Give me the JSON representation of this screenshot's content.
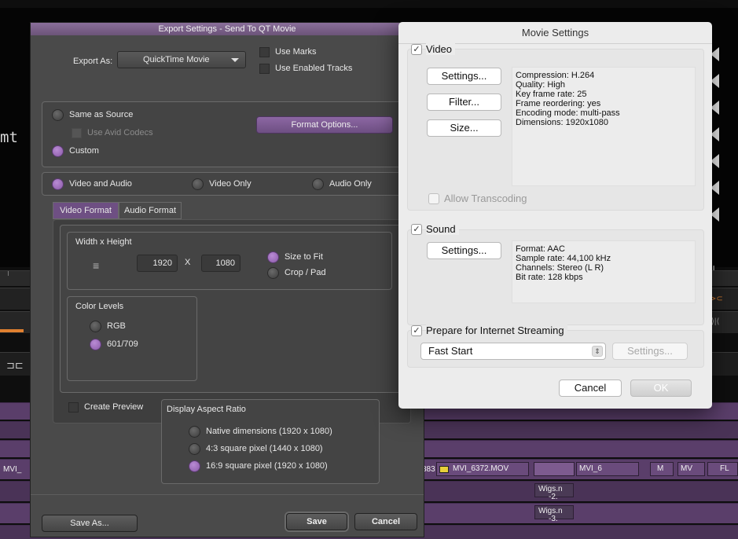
{
  "background": {
    "viewer_text": "mt",
    "viewer_ii": "II",
    "bar_right_glyph": "⊳⊂",
    "bar_right_glyph2": "⟩|⟨",
    "bar_left_glyph": "⊐⊏",
    "clips": {
      "mvi_left": "MVI_",
      "mvi_383": "383",
      "mvi_6372": "MVI_6372.MOV",
      "mvi_6": "MVI_6",
      "m": "M",
      "mv": "MV",
      "fl": "FL",
      "wigs1": "Wigs.n",
      "wigs2": "Wigs.n",
      "gain1": "-2.",
      "gain2": "-3."
    }
  },
  "export": {
    "title": "Export Settings - Send To QT Movie",
    "export_as_label": "Export As:",
    "export_as_value": "QuickTime Movie",
    "use_marks": "Use Marks",
    "use_enabled_tracks": "Use Enabled Tracks",
    "same_as_source": "Same as Source",
    "use_avid_codecs": "Use Avid Codecs",
    "custom": "Custom",
    "format_options": "Format Options...",
    "video_and_audio": "Video and Audio",
    "video_only": "Video Only",
    "audio_only": "Audio Only",
    "tab_video_format": "Video Format",
    "tab_audio_format": "Audio Format",
    "width_x_height": "Width x Height",
    "width_value": "1920",
    "x_sep": "X",
    "height_value": "1080",
    "size_to_fit": "Size to Fit",
    "crop_pad": "Crop / Pad",
    "color_levels": "Color Levels",
    "rgb": "RGB",
    "rec601_709": "601/709",
    "create_preview": "Create Preview",
    "display_aspect_ratio": "Display Aspect Ratio",
    "native_dimensions": "Native dimensions  (1920 x 1080)",
    "square_43": "4:3 square pixel   (1440 x 1080)",
    "square_169": "16:9 square pixel  (1920 x 1080)",
    "save_as": "Save As...",
    "save": "Save",
    "cancel": "Cancel"
  },
  "movie": {
    "title": "Movie Settings",
    "video_label": "Video",
    "video_checked": "✓",
    "settings": "Settings...",
    "filter": "Filter...",
    "size": "Size...",
    "video_info": [
      "Compression: H.264",
      "Quality: High",
      "Key frame rate: 25",
      "Frame reordering: yes",
      "Encoding mode: multi-pass",
      "Dimensions: 1920x1080"
    ],
    "allow_transcoding": "Allow Transcoding",
    "sound_label": "Sound",
    "sound_checked": "✓",
    "sound_settings": "Settings...",
    "sound_info": [
      "Format: AAC",
      "Sample rate: 44,100 kHz",
      "Channels: Stereo (L R)",
      "Bit rate: 128 kbps"
    ],
    "prepare_streaming": "Prepare for Internet Streaming",
    "streaming_checked": "✓",
    "streaming_option": "Fast Start",
    "stepper_glyph": "⇕",
    "streaming_settings": "Settings...",
    "cancel": "Cancel",
    "ok": "OK"
  }
}
